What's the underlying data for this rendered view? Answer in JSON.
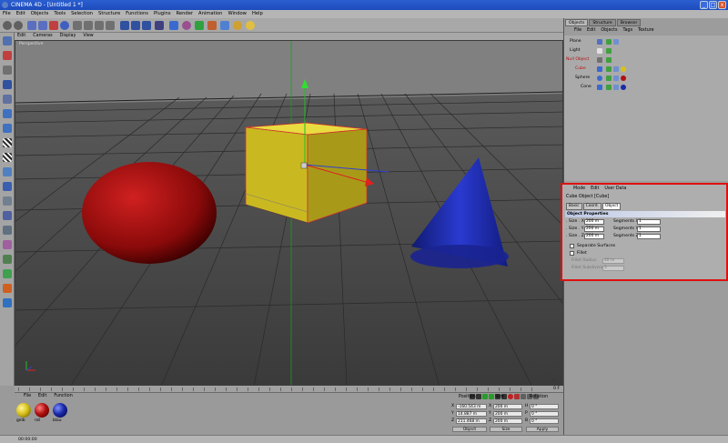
{
  "window": {
    "title": "CINEMA 4D - [Untitled 1 *]",
    "min": "_",
    "max": "□",
    "close": "x"
  },
  "menu": [
    "File",
    "Edit",
    "Objects",
    "Tools",
    "Selection",
    "Structure",
    "Functions",
    "Plugins",
    "Render",
    "Animation",
    "Window",
    "Help"
  ],
  "viewport": {
    "menu": [
      "Edit",
      "Cameras",
      "Display",
      "View"
    ],
    "label": "Perspective",
    "frame": "0 F"
  },
  "right_tabs": [
    "Objects",
    "Structure",
    "Browser"
  ],
  "object_manager": {
    "menu": [
      "File",
      "Edit",
      "Objects",
      "Tags",
      "Texture"
    ],
    "objects": [
      {
        "name": "Plane"
      },
      {
        "name": "Light"
      },
      {
        "name": "Null Object"
      },
      {
        "name": "Cube"
      },
      {
        "name": "Sphere"
      },
      {
        "name": "Cone"
      }
    ]
  },
  "attribute_manager": {
    "menu": [
      "Mode",
      "Edit",
      "User Data"
    ],
    "title": "Cube Object [Cube]",
    "tabs": [
      "Basic",
      "Coord.",
      "Object"
    ],
    "section": "Object Properties",
    "size_rows": [
      {
        "label": ". Size . X",
        "value": "200 m",
        "seg_label": "Segments X",
        "seg_value": "1"
      },
      {
        "label": ". Size . Y",
        "value": "200 m",
        "seg_label": "Segments Y",
        "seg_value": "1"
      },
      {
        "label": ". Size . Z",
        "value": "200 m",
        "seg_label": "Segments Z",
        "seg_value": "1"
      }
    ],
    "separate_surfaces": "Separate Surfaces",
    "fillet": "Fillet",
    "fillet_radius_label": "Fillet Radius",
    "fillet_radius_value": "40 m",
    "fillet_subdiv_label": "Fillet Subdivision",
    "fillet_subdiv_value": "5"
  },
  "materials": {
    "menu": [
      "File",
      "Edit",
      "Function"
    ],
    "items": [
      {
        "name": "gelb",
        "color": "#d8c21a"
      },
      {
        "name": "rot",
        "color": "#b01010"
      },
      {
        "name": "blau",
        "color": "#1a2aa8"
      }
    ]
  },
  "coordinates": {
    "headers": [
      "Position",
      "Size",
      "Rotation"
    ],
    "rows": [
      {
        "axis": "X",
        "pos": "-160.543 m",
        "size": "200 m",
        "rot_axis": "H",
        "rot": "0 °"
      },
      {
        "axis": "Y",
        "pos": "14.887 m",
        "size": "200 m",
        "rot_axis": "P",
        "rot": "0 °"
      },
      {
        "axis": "Z",
        "pos": "211.468 m",
        "size": "200 m",
        "rot_axis": "B",
        "rot": "0 °"
      }
    ],
    "mode1": "Object",
    "mode2": "Size",
    "apply": "Apply"
  },
  "status": "00:00:00"
}
